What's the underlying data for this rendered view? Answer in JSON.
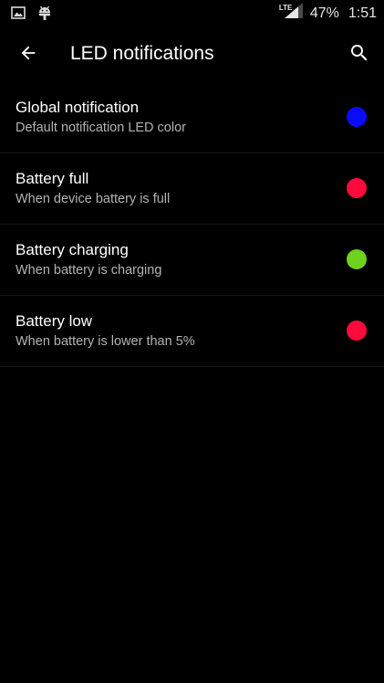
{
  "status_bar": {
    "icons_left": [
      "image-icon",
      "android-icon"
    ],
    "network_type": "LTE",
    "battery_percent": "47%",
    "time": "1:51"
  },
  "toolbar": {
    "back_icon": "arrow-back-icon",
    "title": "LED notifications",
    "search_icon": "search-icon"
  },
  "led_items": [
    {
      "title": "Global notification",
      "summary": "Default notification LED color",
      "color": "#0a0aff"
    },
    {
      "title": "Battery full",
      "summary": "When device battery is full",
      "color": "#ff0a3c"
    },
    {
      "title": "Battery charging",
      "summary": "When battery is charging",
      "color": "#6fd21e"
    },
    {
      "title": "Battery low",
      "summary": "When battery is lower than 5%",
      "color": "#ff0a3c"
    }
  ],
  "colors": {
    "background": "#000000",
    "primary_text": "#ffffff",
    "secondary_text": "#b3b3b3"
  }
}
